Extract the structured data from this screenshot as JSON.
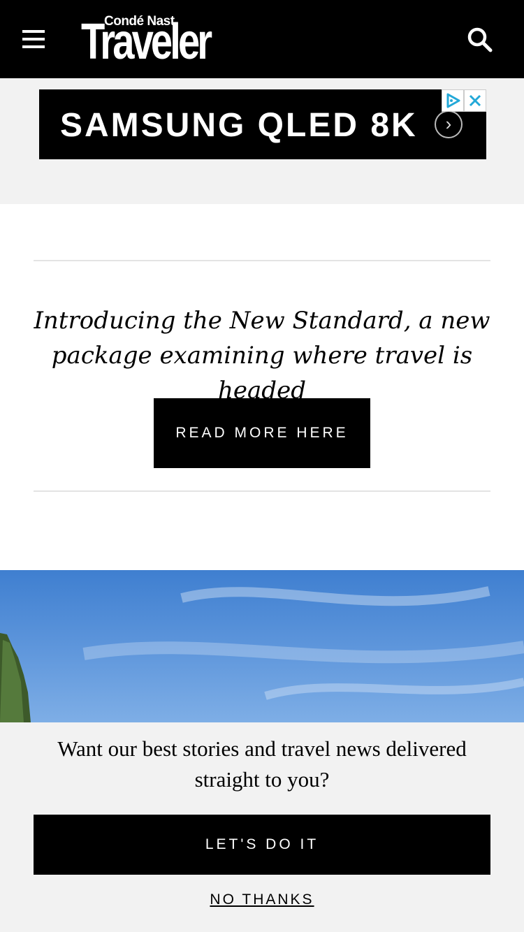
{
  "header": {
    "logo_small": "Condé Nast",
    "logo_big": "Traveler",
    "menu_icon": "hamburger-menu-icon",
    "search_icon": "search-icon",
    "background": "#000000"
  },
  "ad": {
    "text": "SAMSUNG QLED 8K",
    "arrow": "›",
    "choices_icon": "adchoices-icon",
    "close_icon": "close-icon"
  },
  "promo": {
    "headline": "Introducing the New Standard, a new package examining where travel is headed",
    "button_label": "READ MORE HERE"
  },
  "newsletter": {
    "prompt": "Want our best stories and travel news delivered straight to you?",
    "cta_label": "LET'S DO IT",
    "decline_label": "NO THANKS"
  }
}
